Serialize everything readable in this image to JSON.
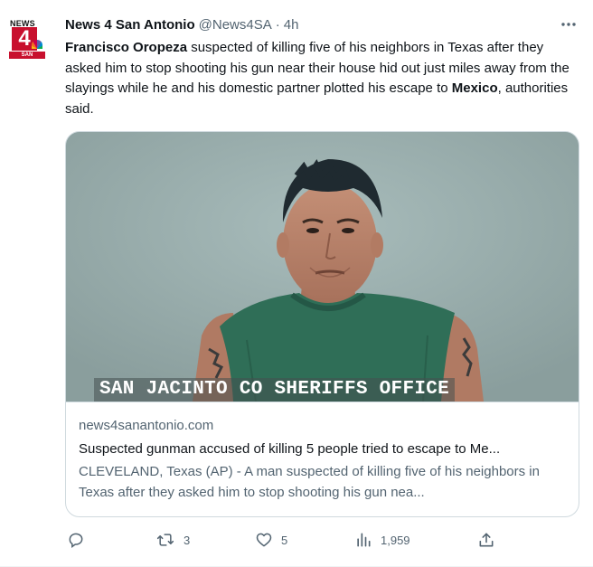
{
  "tweet": {
    "author_name": "News 4 San Antonio",
    "handle": "@News4SA",
    "separator": "·",
    "time": "4h",
    "text_parts": {
      "p1": "Francisco Oropeza",
      "p2": " suspected of killing five of his neighbors in Texas after they asked him to stop shooting his gun near their house hid out just miles away from the slayings while he and his domestic partner plotted his escape to ",
      "p3": "Mexico",
      "p4": ", authorities said."
    }
  },
  "avatar": {
    "top_text": "NEWS",
    "number": "4",
    "bottom_text": "SAN ANTONIO"
  },
  "card": {
    "image_caption": "SAN JACINTO CO SHERIFFS OFFICE",
    "domain": "news4sanantonio.com",
    "title": "Suspected gunman accused of killing 5 people tried to escape to Me...",
    "description": "CLEVELAND, Texas (AP) - A man suspected of killing five of his neighbors in Texas after they asked him to stop shooting his gun nea..."
  },
  "actions": {
    "reply_count": "",
    "retweet_count": "3",
    "like_count": "5",
    "views_count": "1,959"
  },
  "colors": {
    "text_primary": "#0f1419",
    "text_secondary": "#536471",
    "border": "#cfd9de",
    "brand_red": "#c8102e"
  },
  "icons": [
    "more-icon",
    "reply-icon",
    "retweet-icon",
    "like-icon",
    "views-icon",
    "share-icon"
  ]
}
